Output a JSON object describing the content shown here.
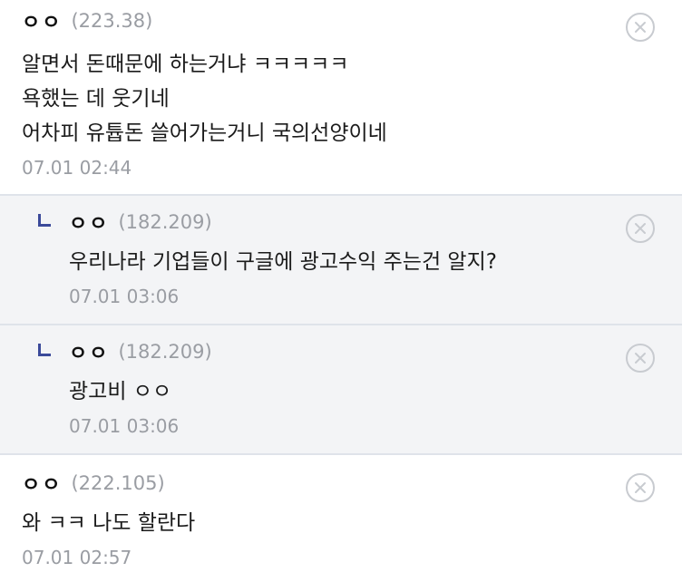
{
  "comments": [
    {
      "nick": "ㅇㅇ",
      "ip": "(223.38)",
      "lines": [
        "알면서 돈때문에 하는거냐 ㅋㅋㅋㅋㅋ",
        "욕했는 데 웃기네",
        "어차피 유튭돈 쓸어가는거니 국의선양이네"
      ],
      "date": "07.01 02:44",
      "delete_icon": "close-circle-icon"
    },
    {
      "nick": "ㅇㅇ",
      "ip": "(182.209)",
      "lines": [
        "우리나라 기업들이 구글에 광고수익 주는건 알지?"
      ],
      "date": "07.01 03:06",
      "reply_icon": "reply-arrow-icon",
      "delete_icon": "close-circle-icon"
    },
    {
      "nick": "ㅇㅇ",
      "ip": "(182.209)",
      "lines": [
        "광고비 ㅇㅇ"
      ],
      "date": "07.01 03:06",
      "reply_icon": "reply-arrow-icon",
      "delete_icon": "close-circle-icon"
    },
    {
      "nick": "ㅇㅇ",
      "ip": "(222.105)",
      "lines": [
        "와 ㅋㅋ 나도 할란다"
      ],
      "date": "07.01 02:57",
      "delete_icon": "close-circle-icon"
    }
  ],
  "colors": {
    "reply_bg": "#f3f4f6",
    "divider": "#dfe3ea",
    "meta_text": "#9a9da3",
    "reply_mark": "#3b4a9a"
  }
}
